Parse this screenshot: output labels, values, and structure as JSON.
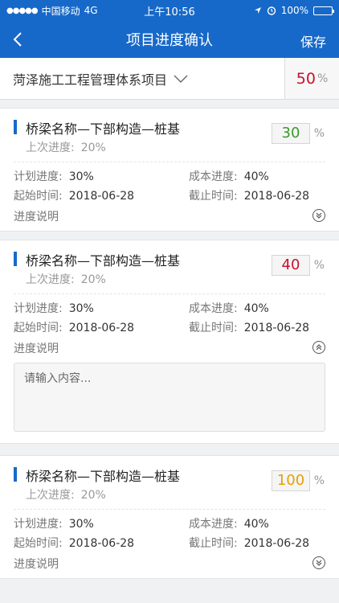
{
  "status_bar": {
    "carrier": "中国移动",
    "network": "4G",
    "time": "上午10:56",
    "battery": "100%"
  },
  "navbar": {
    "title": "项目进度确认",
    "save_label": "保存"
  },
  "project": {
    "name": "菏泽施工工程管理体系项目",
    "percent": "50",
    "percent_unit": "%"
  },
  "cards": [
    {
      "name": "桥梁名称—下部构造—桩基",
      "last_label": "上次进度:",
      "last_value": "20%",
      "current": "30",
      "current_color": "#3a9a2b",
      "unit": "%",
      "plan_label": "计划进度:",
      "plan_value": "30%",
      "cost_label": "成本进度:",
      "cost_value": "40%",
      "start_label": "起始时间:",
      "start_value": "2018-06-28",
      "end_label": "截止时间:",
      "end_value": "2018-06-28",
      "desc_label": "进度说明",
      "expanded": false
    },
    {
      "name": "桥梁名称—下部构造—桩基",
      "last_label": "上次进度:",
      "last_value": "20%",
      "current": "40",
      "current_color": "#c8102e",
      "unit": "%",
      "plan_label": "计划进度:",
      "plan_value": "30%",
      "cost_label": "成本进度:",
      "cost_value": "40%",
      "start_label": "起始时间:",
      "start_value": "2018-06-28",
      "end_label": "截止时间:",
      "end_value": "2018-06-28",
      "desc_label": "进度说明",
      "expanded": true,
      "desc_placeholder": "请输入内容..."
    },
    {
      "name": "桥梁名称—下部构造—桩基",
      "last_label": "上次进度:",
      "last_value": "20%",
      "current": "100",
      "current_color": "#e8a000",
      "unit": "%",
      "plan_label": "计划进度:",
      "plan_value": "30%",
      "cost_label": "成本进度:",
      "cost_value": "40%",
      "start_label": "起始时间:",
      "start_value": "2018-06-28",
      "end_label": "截止时间:",
      "end_value": "2018-06-28",
      "desc_label": "进度说明",
      "expanded": false
    }
  ],
  "colors": {
    "brand": "#1769c9",
    "project_percent": "#c8102e"
  }
}
